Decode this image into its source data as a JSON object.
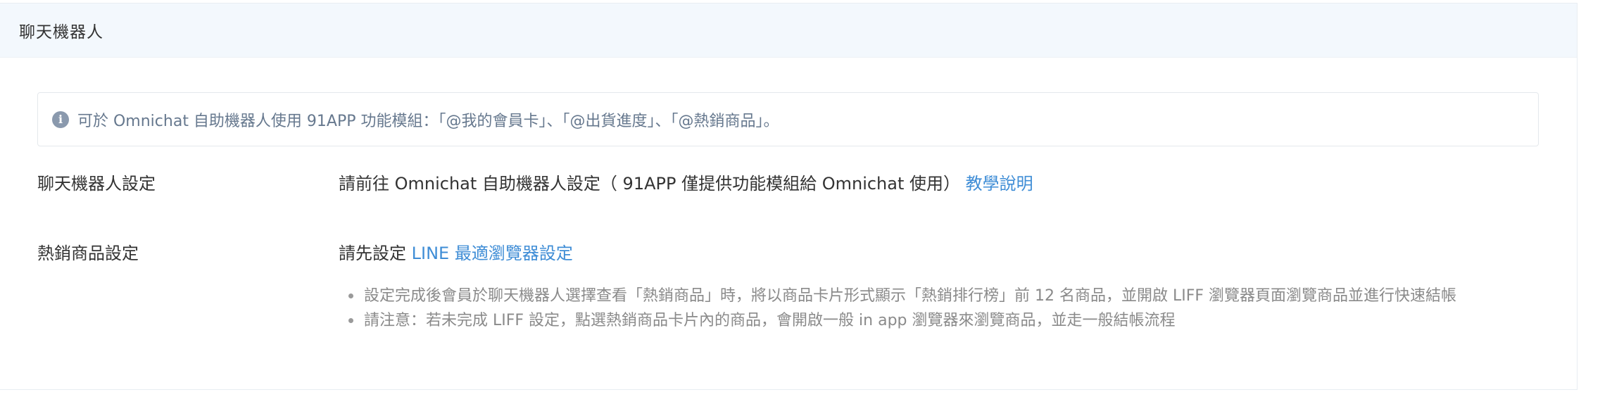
{
  "panel": {
    "title": "聊天機器人"
  },
  "info": {
    "icon": "info-circle-icon",
    "text": "可於 Omnichat 自助機器人使用 91APP 功能模組：「@我的會員卡」、「@出貨進度」、「@熱銷商品」。"
  },
  "chatbot_setting": {
    "label": "聊天機器人設定",
    "text": "請前往 Omnichat 自助機器人設定（ 91APP 僅提供功能模組給 Omnichat 使用）",
    "link": "教學說明"
  },
  "hot_products_setting": {
    "label": "熱銷商品設定",
    "prefix": "請先設定",
    "link": "LINE 最適瀏覽器設定",
    "notes": [
      "設定完成後會員於聊天機器人選擇查看「熱銷商品」時，將以商品卡片形式顯示「熱銷排行榜」前 12 名商品，並開啟 LIFF 瀏覽器頁面瀏覽商品並進行快速結帳",
      "請注意：若未完成 LIFF 設定，點選熱銷商品卡片內的商品，會開啟一般 in app 瀏覽器來瀏覽商品，並走一般結帳流程"
    ]
  },
  "colors": {
    "header_bg": "#f3f8fd",
    "link": "#3f8dd6",
    "info_text": "#66788e",
    "note_text": "#8a8a8a"
  }
}
